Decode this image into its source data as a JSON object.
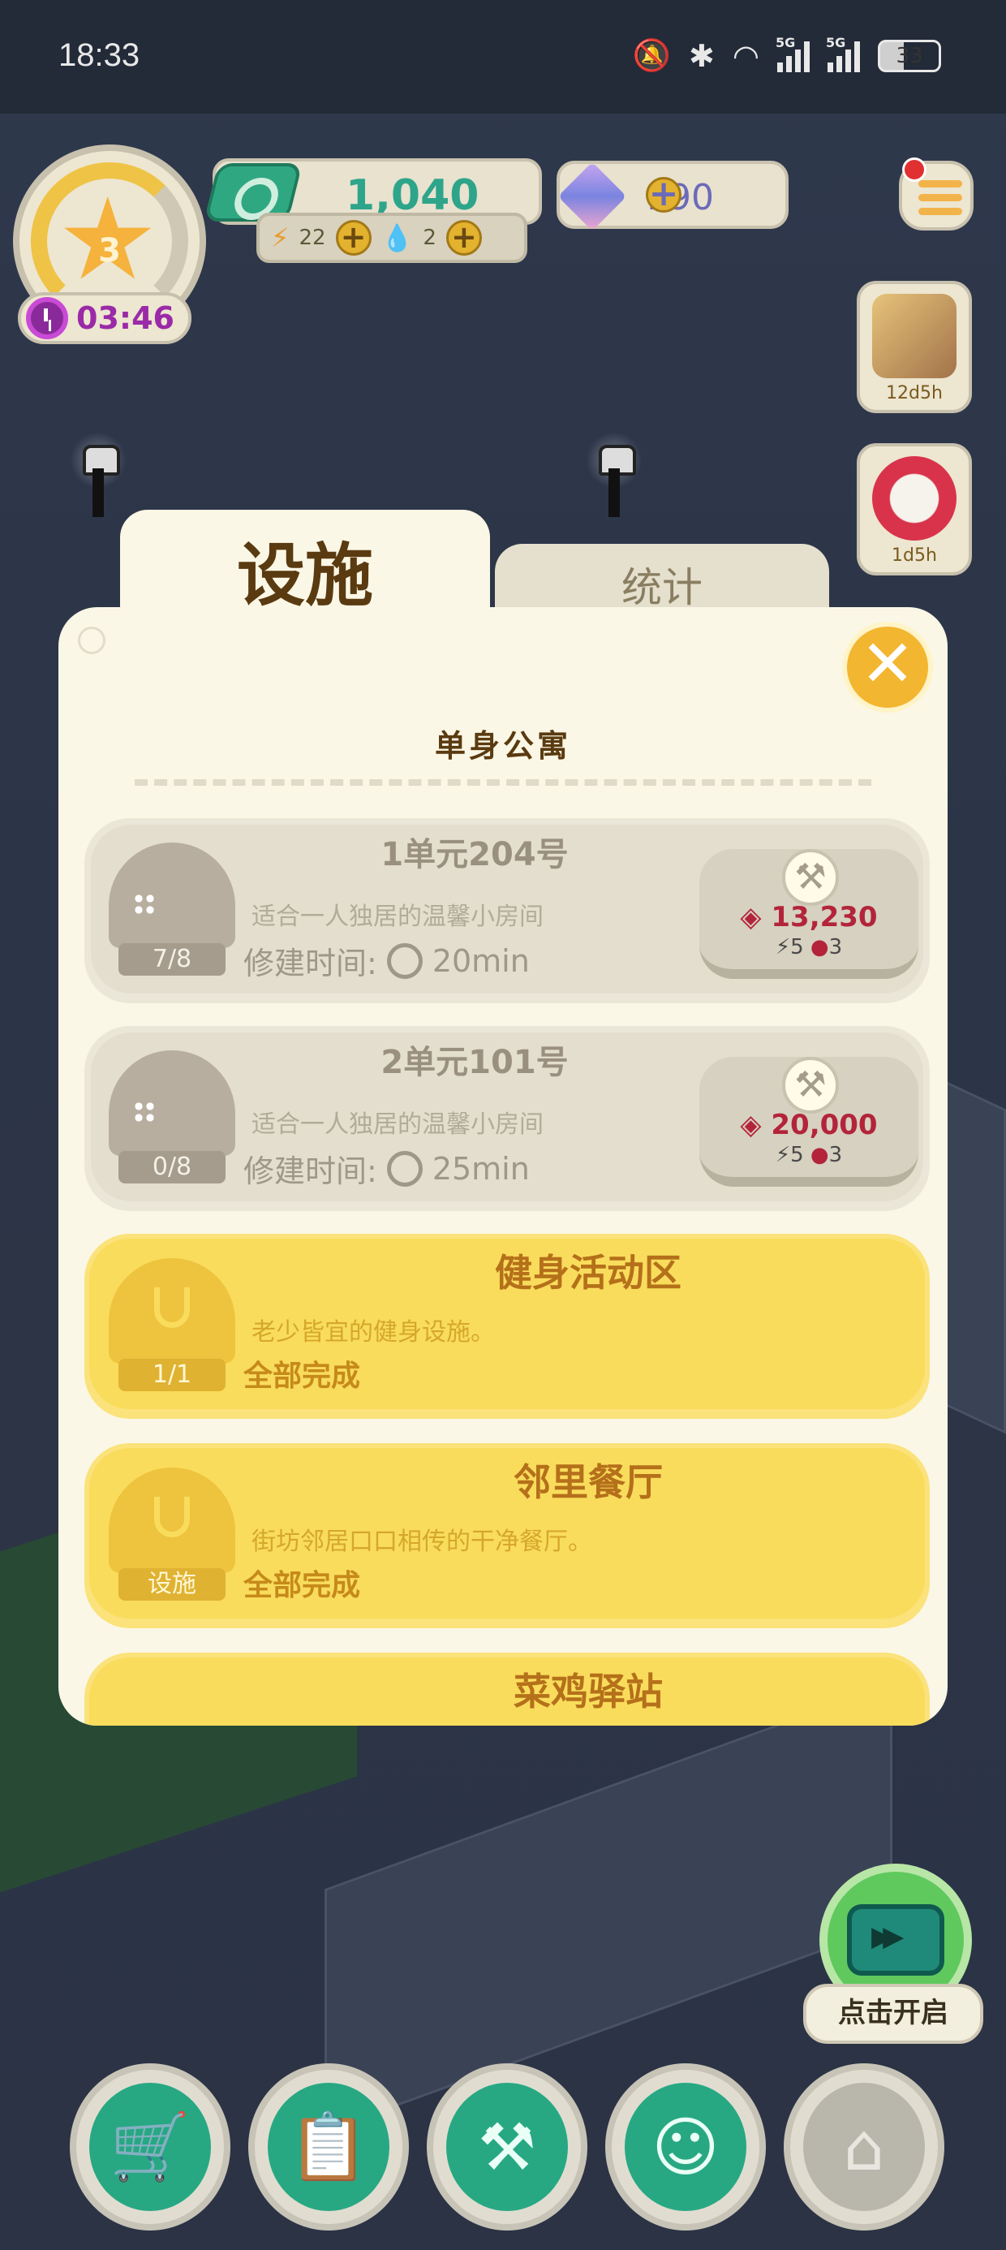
{
  "status_bar": {
    "time": "18:33",
    "icons": [
      "mute-icon",
      "bluetooth-icon",
      "wifi-icon",
      "signal-5g-icon",
      "signal-5g-icon"
    ],
    "signal_labels": [
      "5G",
      "5G"
    ],
    "battery": "33"
  },
  "hud": {
    "level": "3",
    "timer": "03:46",
    "coins": "1,040",
    "energy": "22",
    "water": "2",
    "diamonds": "190",
    "events": [
      {
        "label": "12d5h",
        "icon": "map-book-icon"
      },
      {
        "label": "1d5h",
        "icon": "dice-icon"
      }
    ]
  },
  "tabs": {
    "active": "设施",
    "inactive": "统计"
  },
  "panel": {
    "title": "单身公寓",
    "items": [
      {
        "name": "1单元204号",
        "desc": "适合一人独居的温馨小房间",
        "time_label": "修建时间:",
        "time_value": "20min",
        "progress": "7/8",
        "cost": "13,230",
        "energy": "5",
        "water": "3"
      },
      {
        "name": "2单元101号",
        "desc": "适合一人独居的温馨小房间",
        "time_label": "修建时间:",
        "time_value": "25min",
        "progress": "0/8",
        "cost": "20,000",
        "energy": "5",
        "water": "3"
      },
      {
        "name": "健身活动区",
        "desc": "老少皆宜的健身设施。",
        "status": "全部完成",
        "progress": "1/1"
      },
      {
        "name": "邻里餐厅",
        "desc": "街坊邻居口口相传的干净餐厅。",
        "status": "全部完成",
        "progress": "设施"
      },
      {
        "name": "菜鸡驿站"
      }
    ]
  },
  "video_button": {
    "label": "点击开启"
  },
  "bottom_nav": [
    {
      "name": "shop",
      "icon": "cart-icon"
    },
    {
      "name": "tasks",
      "icon": "clipboard-icon"
    },
    {
      "name": "build",
      "icon": "tools-icon"
    },
    {
      "name": "social",
      "icon": "smiley-icon"
    },
    {
      "name": "home",
      "icon": "house-icon"
    }
  ]
}
